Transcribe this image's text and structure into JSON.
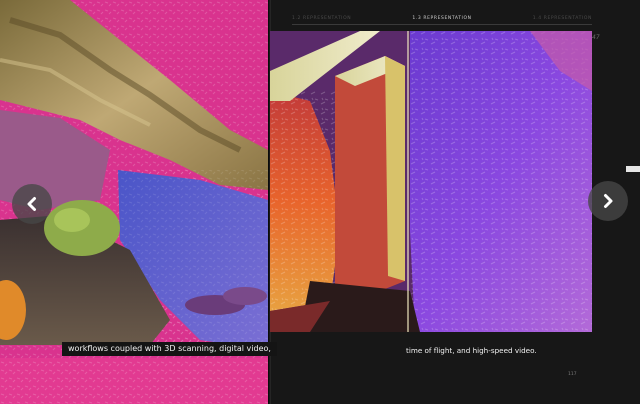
{
  "navigation": {
    "sections": [
      "1.2 REPRESENTATION",
      "1.3 REPRESENTATION",
      "1.4 REPRESENTATION"
    ],
    "active_index": 1,
    "prev_icon": "chevron-left-icon",
    "next_icon": "chevron-right-icon"
  },
  "left_page": {
    "caption": "workflows coupled with 3D scanning, digital video,"
  },
  "right_page": {
    "caption": "time of flight, and high-speed video.",
    "folio": "117",
    "page_mark": "47"
  },
  "side_index": {
    "entries": [
      "",
      "",
      "",
      "",
      "",
      "",
      "",
      "",
      ""
    ],
    "active_entry": 3
  },
  "colors": {
    "magenta": "#e0348f",
    "violet": "#7b3fd6",
    "orange": "#e8642c",
    "cream": "#e8e4b8",
    "background": "#171717"
  }
}
